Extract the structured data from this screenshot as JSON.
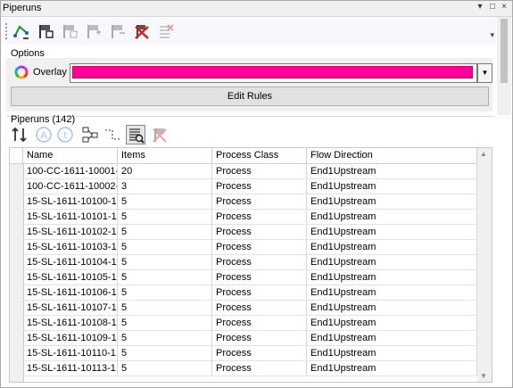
{
  "window": {
    "title": "Piperuns"
  },
  "title_controls": {
    "dropdown": "▾",
    "restore": "□",
    "close": "×"
  },
  "toolbar": {
    "buttons": [
      {
        "icon": "route-path-icon"
      },
      {
        "icon": "flag-select-icon"
      },
      {
        "icon": "flag-assign-icon"
      },
      {
        "icon": "flag-add-icon"
      },
      {
        "icon": "flag-remove-icon"
      },
      {
        "icon": "delete-x-icon"
      },
      {
        "icon": "list-clear-icon"
      }
    ],
    "more": "▾"
  },
  "options": {
    "label": "Options",
    "overlay_label": "Overlay",
    "overlay_color": "#ff0099",
    "dropdown_arrow": "▼",
    "edit_rules": "Edit Rules"
  },
  "piperuns": {
    "label": "Piperuns (142)",
    "columns": [
      "Name",
      "Items",
      "Process Class",
      "Flow Direction"
    ],
    "rows": [
      [
        "100-CC-1611-10001-...",
        "20",
        "Process",
        "End1Upstream"
      ],
      [
        "100-CC-1611-10002-...",
        "3",
        "Process",
        "End1Upstream"
      ],
      [
        "15-SL-1611-10100-1...",
        "5",
        "Process",
        "End1Upstream"
      ],
      [
        "15-SL-1611-10101-1...",
        "5",
        "Process",
        "End1Upstream"
      ],
      [
        "15-SL-1611-10102-1...",
        "5",
        "Process",
        "End1Upstream"
      ],
      [
        "15-SL-1611-10103-1...",
        "5",
        "Process",
        "End1Upstream"
      ],
      [
        "15-SL-1611-10104-1...",
        "5",
        "Process",
        "End1Upstream"
      ],
      [
        "15-SL-1611-10105-1...",
        "5",
        "Process",
        "End1Upstream"
      ],
      [
        "15-SL-1611-10106-1...",
        "5",
        "Process",
        "End1Upstream"
      ],
      [
        "15-SL-1611-10107-1...",
        "5",
        "Process",
        "End1Upstream"
      ],
      [
        "15-SL-1611-10108-1...",
        "5",
        "Process",
        "End1Upstream"
      ],
      [
        "15-SL-1611-10109-1...",
        "5",
        "Process",
        "End1Upstream"
      ],
      [
        "15-SL-1611-10110-1...",
        "5",
        "Process",
        "End1Upstream"
      ],
      [
        "15-SL-1611-10113-1...",
        "5",
        "Process",
        "End1Upstream"
      ]
    ],
    "scroll_up": "▲",
    "scroll_down": "▼"
  }
}
